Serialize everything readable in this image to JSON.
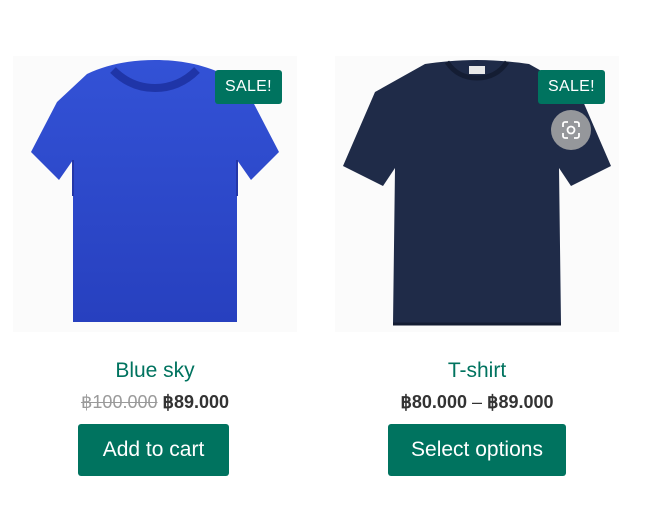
{
  "products": [
    {
      "name": "Blue sky",
      "badge": "SALE!",
      "image_color": "#2f49c8",
      "price_old": "฿100.000",
      "price_new": "฿89.000",
      "button": "Add to cart"
    },
    {
      "name": "T-shirt",
      "badge": "SALE!",
      "image_color": "#1e2a46",
      "price_range_low": "฿80.000",
      "price_range_separator": "–",
      "price_range_high": "฿89.000",
      "button": "Select options",
      "zoom_icon": "zoom-scan-icon"
    }
  ],
  "colors": {
    "accent": "#00735f",
    "text": "#333333",
    "muted": "#9a9a9a"
  }
}
